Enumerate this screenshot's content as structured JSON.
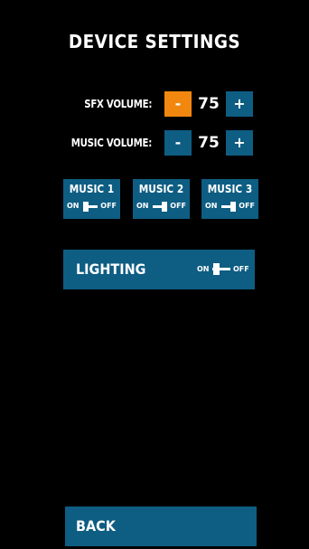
{
  "title": "DEVICE SETTINGS",
  "sfx": {
    "label": "SFX VOLUME:",
    "minus": "-",
    "value": "75",
    "plus": "+",
    "minus_active": true
  },
  "music_volume": {
    "label": "MUSIC VOLUME:",
    "minus": "-",
    "value": "75",
    "plus": "+"
  },
  "music_tracks": [
    {
      "label": "MUSIC 1",
      "on": "ON",
      "off": "OFF",
      "state": "on"
    },
    {
      "label": "MUSIC 2",
      "on": "ON",
      "off": "OFF",
      "state": "off"
    },
    {
      "label": "MUSIC 3",
      "on": "ON",
      "off": "OFF",
      "state": "off"
    }
  ],
  "lighting": {
    "label": "LIGHTING",
    "on": "ON",
    "off": "OFF",
    "state": "on"
  },
  "back": {
    "label": "BACK"
  },
  "colors": {
    "background": "#000000",
    "button": "#0e5d83",
    "active": "#f2870f",
    "text": "#ffffff"
  }
}
